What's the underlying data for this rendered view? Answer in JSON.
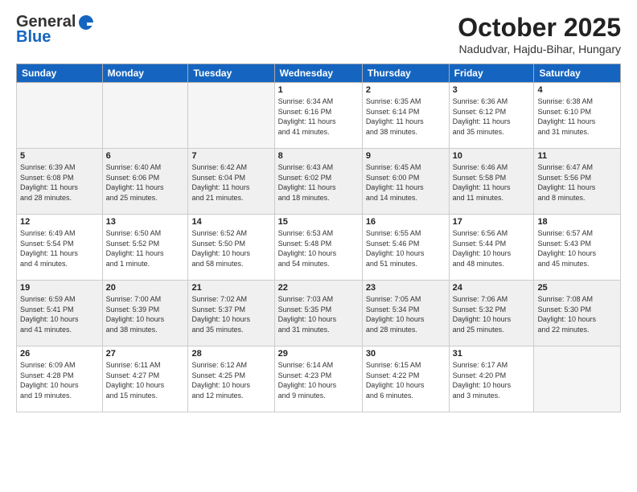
{
  "header": {
    "logo": {
      "general": "General",
      "blue": "Blue"
    },
    "title": "October 2025",
    "location": "Nadudvar, Hajdu-Bihar, Hungary"
  },
  "calendar": {
    "days_of_week": [
      "Sunday",
      "Monday",
      "Tuesday",
      "Wednesday",
      "Thursday",
      "Friday",
      "Saturday"
    ],
    "weeks": [
      {
        "shaded": false,
        "days": [
          {
            "num": "",
            "info": ""
          },
          {
            "num": "",
            "info": ""
          },
          {
            "num": "",
            "info": ""
          },
          {
            "num": "1",
            "info": "Sunrise: 6:34 AM\nSunset: 6:16 PM\nDaylight: 11 hours\nand 41 minutes."
          },
          {
            "num": "2",
            "info": "Sunrise: 6:35 AM\nSunset: 6:14 PM\nDaylight: 11 hours\nand 38 minutes."
          },
          {
            "num": "3",
            "info": "Sunrise: 6:36 AM\nSunset: 6:12 PM\nDaylight: 11 hours\nand 35 minutes."
          },
          {
            "num": "4",
            "info": "Sunrise: 6:38 AM\nSunset: 6:10 PM\nDaylight: 11 hours\nand 31 minutes."
          }
        ]
      },
      {
        "shaded": true,
        "days": [
          {
            "num": "5",
            "info": "Sunrise: 6:39 AM\nSunset: 6:08 PM\nDaylight: 11 hours\nand 28 minutes."
          },
          {
            "num": "6",
            "info": "Sunrise: 6:40 AM\nSunset: 6:06 PM\nDaylight: 11 hours\nand 25 minutes."
          },
          {
            "num": "7",
            "info": "Sunrise: 6:42 AM\nSunset: 6:04 PM\nDaylight: 11 hours\nand 21 minutes."
          },
          {
            "num": "8",
            "info": "Sunrise: 6:43 AM\nSunset: 6:02 PM\nDaylight: 11 hours\nand 18 minutes."
          },
          {
            "num": "9",
            "info": "Sunrise: 6:45 AM\nSunset: 6:00 PM\nDaylight: 11 hours\nand 14 minutes."
          },
          {
            "num": "10",
            "info": "Sunrise: 6:46 AM\nSunset: 5:58 PM\nDaylight: 11 hours\nand 11 minutes."
          },
          {
            "num": "11",
            "info": "Sunrise: 6:47 AM\nSunset: 5:56 PM\nDaylight: 11 hours\nand 8 minutes."
          }
        ]
      },
      {
        "shaded": false,
        "days": [
          {
            "num": "12",
            "info": "Sunrise: 6:49 AM\nSunset: 5:54 PM\nDaylight: 11 hours\nand 4 minutes."
          },
          {
            "num": "13",
            "info": "Sunrise: 6:50 AM\nSunset: 5:52 PM\nDaylight: 11 hours\nand 1 minute."
          },
          {
            "num": "14",
            "info": "Sunrise: 6:52 AM\nSunset: 5:50 PM\nDaylight: 10 hours\nand 58 minutes."
          },
          {
            "num": "15",
            "info": "Sunrise: 6:53 AM\nSunset: 5:48 PM\nDaylight: 10 hours\nand 54 minutes."
          },
          {
            "num": "16",
            "info": "Sunrise: 6:55 AM\nSunset: 5:46 PM\nDaylight: 10 hours\nand 51 minutes."
          },
          {
            "num": "17",
            "info": "Sunrise: 6:56 AM\nSunset: 5:44 PM\nDaylight: 10 hours\nand 48 minutes."
          },
          {
            "num": "18",
            "info": "Sunrise: 6:57 AM\nSunset: 5:43 PM\nDaylight: 10 hours\nand 45 minutes."
          }
        ]
      },
      {
        "shaded": true,
        "days": [
          {
            "num": "19",
            "info": "Sunrise: 6:59 AM\nSunset: 5:41 PM\nDaylight: 10 hours\nand 41 minutes."
          },
          {
            "num": "20",
            "info": "Sunrise: 7:00 AM\nSunset: 5:39 PM\nDaylight: 10 hours\nand 38 minutes."
          },
          {
            "num": "21",
            "info": "Sunrise: 7:02 AM\nSunset: 5:37 PM\nDaylight: 10 hours\nand 35 minutes."
          },
          {
            "num": "22",
            "info": "Sunrise: 7:03 AM\nSunset: 5:35 PM\nDaylight: 10 hours\nand 31 minutes."
          },
          {
            "num": "23",
            "info": "Sunrise: 7:05 AM\nSunset: 5:34 PM\nDaylight: 10 hours\nand 28 minutes."
          },
          {
            "num": "24",
            "info": "Sunrise: 7:06 AM\nSunset: 5:32 PM\nDaylight: 10 hours\nand 25 minutes."
          },
          {
            "num": "25",
            "info": "Sunrise: 7:08 AM\nSunset: 5:30 PM\nDaylight: 10 hours\nand 22 minutes."
          }
        ]
      },
      {
        "shaded": false,
        "days": [
          {
            "num": "26",
            "info": "Sunrise: 6:09 AM\nSunset: 4:28 PM\nDaylight: 10 hours\nand 19 minutes."
          },
          {
            "num": "27",
            "info": "Sunrise: 6:11 AM\nSunset: 4:27 PM\nDaylight: 10 hours\nand 15 minutes."
          },
          {
            "num": "28",
            "info": "Sunrise: 6:12 AM\nSunset: 4:25 PM\nDaylight: 10 hours\nand 12 minutes."
          },
          {
            "num": "29",
            "info": "Sunrise: 6:14 AM\nSunset: 4:23 PM\nDaylight: 10 hours\nand 9 minutes."
          },
          {
            "num": "30",
            "info": "Sunrise: 6:15 AM\nSunset: 4:22 PM\nDaylight: 10 hours\nand 6 minutes."
          },
          {
            "num": "31",
            "info": "Sunrise: 6:17 AM\nSunset: 4:20 PM\nDaylight: 10 hours\nand 3 minutes."
          },
          {
            "num": "",
            "info": ""
          }
        ]
      }
    ]
  }
}
